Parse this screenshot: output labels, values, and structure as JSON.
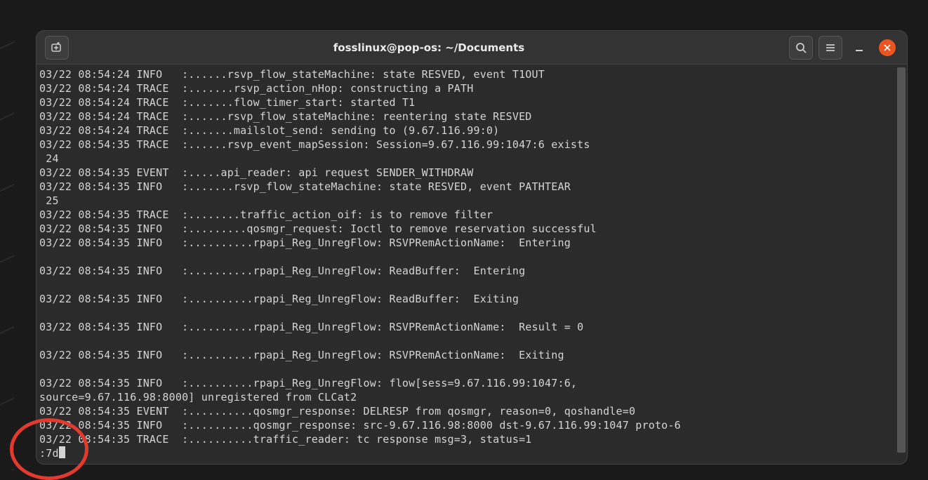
{
  "window": {
    "title": "fosslinux@pop-os: ~/Documents"
  },
  "icons": {
    "new_tab": "new-tab-icon",
    "search": "search-icon",
    "menu": "hamburger-icon",
    "minimize": "minimize-icon",
    "close": "close-icon"
  },
  "terminal": {
    "lines": [
      "03/22 08:54:24 INFO   :......rsvp_flow_stateMachine: state RESVED, event T1OUT",
      "03/22 08:54:24 TRACE  :.......rsvp_action_nHop: constructing a PATH",
      "03/22 08:54:24 TRACE  :.......flow_timer_start: started T1",
      "03/22 08:54:24 TRACE  :......rsvp_flow_stateMachine: reentering state RESVED",
      "03/22 08:54:24 TRACE  :.......mailslot_send: sending to (9.67.116.99:0)",
      "03/22 08:54:35 TRACE  :......rsvp_event_mapSession: Session=9.67.116.99:1047:6 exists",
      " 24",
      "03/22 08:54:35 EVENT  :.....api_reader: api request SENDER_WITHDRAW",
      "03/22 08:54:35 INFO   :.......rsvp_flow_stateMachine: state RESVED, event PATHTEAR",
      " 25",
      "03/22 08:54:35 TRACE  :........traffic_action_oif: is to remove filter",
      "03/22 08:54:35 INFO   :.........qosmgr_request: Ioctl to remove reservation successful",
      "03/22 08:54:35 INFO   :..........rpapi_Reg_UnregFlow: RSVPRemActionName:  Entering",
      "",
      "03/22 08:54:35 INFO   :..........rpapi_Reg_UnregFlow: ReadBuffer:  Entering",
      "",
      "03/22 08:54:35 INFO   :..........rpapi_Reg_UnregFlow: ReadBuffer:  Exiting",
      "",
      "03/22 08:54:35 INFO   :..........rpapi_Reg_UnregFlow: RSVPRemActionName:  Result = 0",
      "",
      "03/22 08:54:35 INFO   :..........rpapi_Reg_UnregFlow: RSVPRemActionName:  Exiting",
      "",
      "03/22 08:54:35 INFO   :..........rpapi_Reg_UnregFlow: flow[sess=9.67.116.99:1047:6,",
      "source=9.67.116.98:8000] unregistered from CLCat2",
      "03/22 08:54:35 EVENT  :..........qosmgr_response: DELRESP from qosmgr, reason=0, qoshandle=0",
      "03/22 08:54:35 INFO   :..........qosmgr_response: src-9.67.116.98:8000 dst-9.67.116.99:1047 proto-6",
      "03/22 08:54:35 TRACE  :..........traffic_reader: tc response msg=3, status=1"
    ],
    "prompt": ":7d"
  },
  "annotation": {
    "color": "#e23a2e"
  }
}
